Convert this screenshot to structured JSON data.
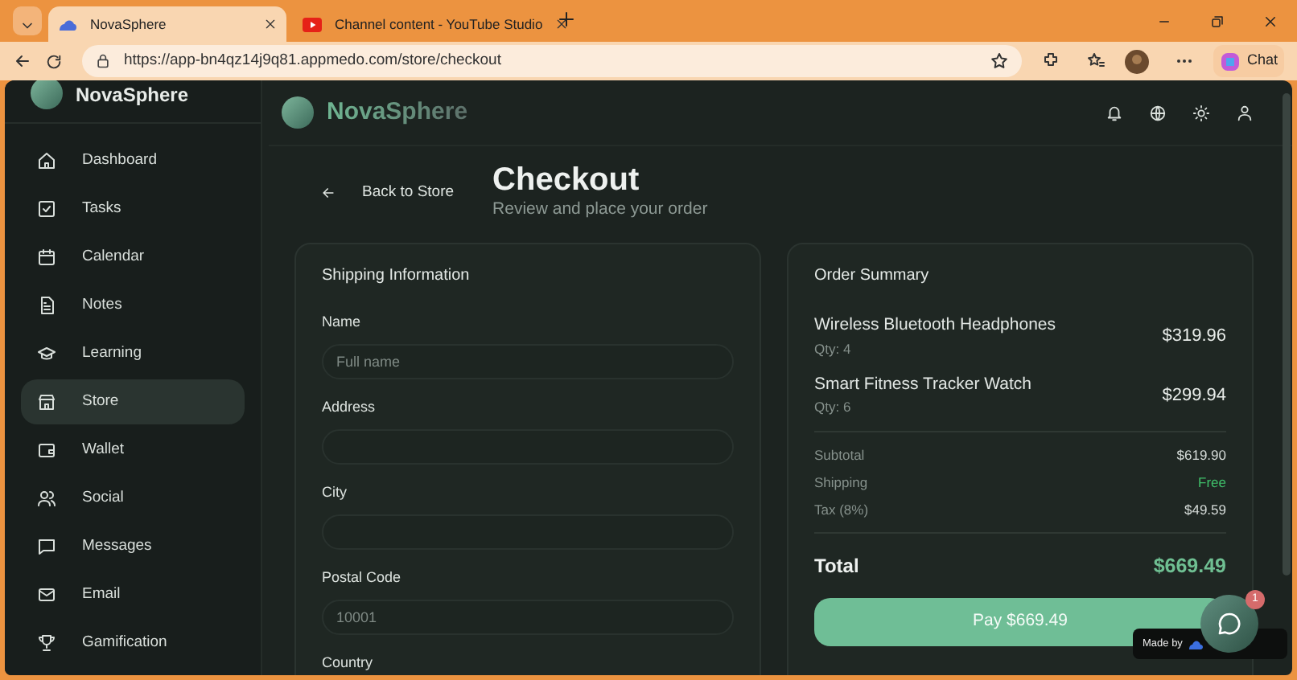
{
  "browser": {
    "tabs": [
      {
        "title": "NovaSphere",
        "selected": true
      },
      {
        "title": "Channel content - YouTube Studio",
        "selected": false
      }
    ],
    "url": "https://app-bn4qz14j9q81.appmedo.com/store/checkout",
    "chat_button": "Chat"
  },
  "sidebar": {
    "brand": "NovaSphere",
    "items": [
      {
        "label": "Dashboard",
        "selected": false
      },
      {
        "label": "Tasks",
        "selected": false
      },
      {
        "label": "Calendar",
        "selected": false
      },
      {
        "label": "Notes",
        "selected": false
      },
      {
        "label": "Learning",
        "selected": false
      },
      {
        "label": "Store",
        "selected": true
      },
      {
        "label": "Wallet",
        "selected": false
      },
      {
        "label": "Social",
        "selected": false
      },
      {
        "label": "Messages",
        "selected": false
      },
      {
        "label": "Email",
        "selected": false
      },
      {
        "label": "Gamification",
        "selected": false
      }
    ]
  },
  "header": {
    "brand": "NovaSphere"
  },
  "page": {
    "back_link": "Back to Store",
    "title": "Checkout",
    "subtitle": "Review and place your order"
  },
  "shipping": {
    "title": "Shipping Information",
    "fields": [
      {
        "label": "Name",
        "placeholder": "Full name"
      },
      {
        "label": "Address"
      },
      {
        "label": "City"
      },
      {
        "label": "Postal Code",
        "placeholder": "10001"
      }
    ],
    "next_label": "Country"
  },
  "order": {
    "title": "Order Summary",
    "items": [
      {
        "name": "Wireless Bluetooth Headphones",
        "qty": "Qty: 4",
        "price": "$319.96"
      },
      {
        "name": "Smart Fitness Tracker Watch",
        "qty": "Qty: 6",
        "price": "$299.94"
      }
    ],
    "summary": [
      {
        "label": "Subtotal",
        "value": "$619.90",
        "kind": "plain"
      },
      {
        "label": "Shipping",
        "value": "Free",
        "kind": "free"
      },
      {
        "label": "Tax (8%)",
        "value": "$49.59",
        "kind": "plain"
      }
    ],
    "total_label": "Total",
    "total_value": "$669.49",
    "pay_button": "Pay $669.49"
  },
  "chat_widget": {
    "badge": "1",
    "made_by": "Made by"
  }
}
